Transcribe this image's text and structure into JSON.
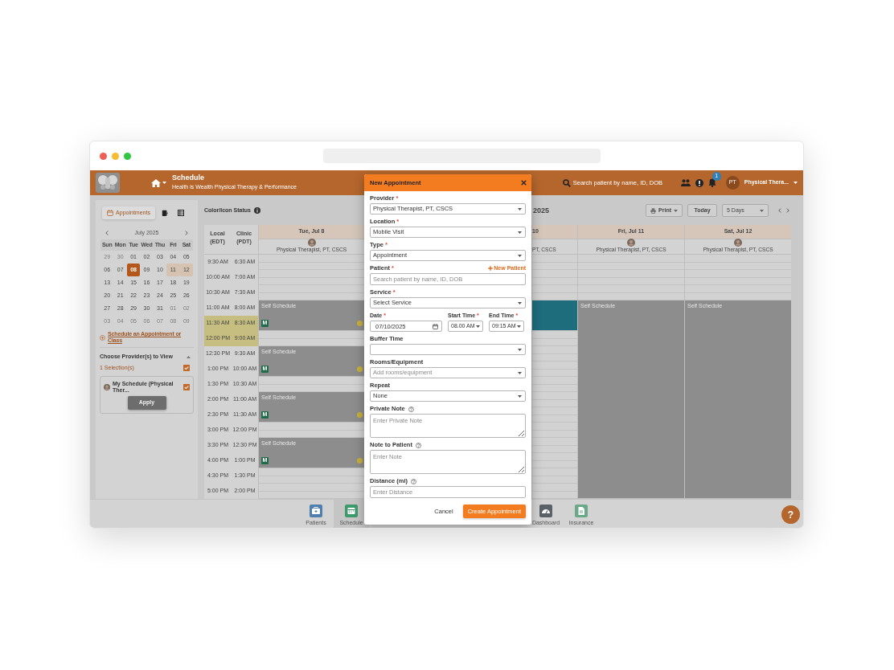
{
  "header": {
    "title": "Schedule",
    "subtitle": "Health is Wealth Physical Therapy & Performance",
    "search_placeholder": "Search patient by name, ID, DOB",
    "notification_count": "1",
    "avatar_initials": "PT",
    "user_name": "Physical Thera..."
  },
  "sidebar": {
    "view_buttons": [
      {
        "kind": "appointments",
        "label": "Appointments",
        "selected": true
      },
      {
        "kind": "notes",
        "selected": false
      },
      {
        "kind": "list",
        "selected": false
      }
    ],
    "month": "July 2025",
    "weekdays": [
      "Sun",
      "Mon",
      "Tue",
      "Wed",
      "Thu",
      "Fri",
      "Sat"
    ],
    "weeks": [
      [
        {
          "label": "29",
          "muted": true,
          "selected": false,
          "highlighted": false
        },
        {
          "label": "30",
          "muted": true,
          "selected": false,
          "highlighted": false
        },
        {
          "label": "01",
          "muted": false,
          "selected": false,
          "highlighted": false
        },
        {
          "label": "02",
          "muted": false,
          "selected": false,
          "highlighted": false
        },
        {
          "label": "03",
          "muted": false,
          "selected": false,
          "highlighted": false
        },
        {
          "label": "04",
          "muted": false,
          "selected": false,
          "highlighted": false
        },
        {
          "label": "05",
          "muted": false,
          "selected": false,
          "highlighted": false
        }
      ],
      [
        {
          "label": "06",
          "muted": false,
          "selected": false,
          "highlighted": false
        },
        {
          "label": "07",
          "muted": false,
          "selected": false,
          "highlighted": false
        },
        {
          "label": "08",
          "muted": false,
          "selected": true,
          "highlighted": false
        },
        {
          "label": "09",
          "muted": false,
          "selected": false,
          "highlighted": false
        },
        {
          "label": "10",
          "muted": false,
          "selected": false,
          "highlighted": false
        },
        {
          "label": "11",
          "muted": false,
          "selected": false,
          "highlighted": true
        },
        {
          "label": "12",
          "muted": false,
          "selected": false,
          "highlighted": true
        }
      ],
      [
        {
          "label": "13",
          "muted": false,
          "selected": false,
          "highlighted": false
        },
        {
          "label": "14",
          "muted": false,
          "selected": false,
          "highlighted": false
        },
        {
          "label": "15",
          "muted": false,
          "selected": false,
          "highlighted": false
        },
        {
          "label": "16",
          "muted": false,
          "selected": false,
          "highlighted": false
        },
        {
          "label": "17",
          "muted": false,
          "selected": false,
          "highlighted": false
        },
        {
          "label": "18",
          "muted": false,
          "selected": false,
          "highlighted": false
        },
        {
          "label": "19",
          "muted": false,
          "selected": false,
          "highlighted": false
        }
      ],
      [
        {
          "label": "20",
          "muted": false,
          "selected": false,
          "highlighted": false
        },
        {
          "label": "21",
          "muted": false,
          "selected": false,
          "highlighted": false
        },
        {
          "label": "22",
          "muted": false,
          "selected": false,
          "highlighted": false
        },
        {
          "label": "23",
          "muted": false,
          "selected": false,
          "highlighted": false
        },
        {
          "label": "24",
          "muted": false,
          "selected": false,
          "highlighted": false
        },
        {
          "label": "25",
          "muted": false,
          "selected": false,
          "highlighted": false
        },
        {
          "label": "26",
          "muted": false,
          "selected": false,
          "highlighted": false
        }
      ],
      [
        {
          "label": "27",
          "muted": false,
          "selected": false,
          "highlighted": false
        },
        {
          "label": "28",
          "muted": false,
          "selected": false,
          "highlighted": false
        },
        {
          "label": "29",
          "muted": false,
          "selected": false,
          "highlighted": false
        },
        {
          "label": "30",
          "muted": false,
          "selected": false,
          "highlighted": false
        },
        {
          "label": "31",
          "muted": false,
          "selected": false,
          "highlighted": false
        },
        {
          "label": "01",
          "muted": true,
          "selected": false,
          "highlighted": false
        },
        {
          "label": "02",
          "muted": true,
          "selected": false,
          "highlighted": false
        }
      ],
      [
        {
          "label": "03",
          "muted": true,
          "selected": false,
          "highlighted": false
        },
        {
          "label": "04",
          "muted": true,
          "selected": false,
          "highlighted": false
        },
        {
          "label": "05",
          "muted": true,
          "selected": false,
          "highlighted": false
        },
        {
          "label": "06",
          "muted": true,
          "selected": false,
          "highlighted": false
        },
        {
          "label": "07",
          "muted": true,
          "selected": false,
          "highlighted": false
        },
        {
          "label": "08",
          "muted": true,
          "selected": false,
          "highlighted": false
        },
        {
          "label": "09",
          "muted": true,
          "selected": false,
          "highlighted": false
        }
      ]
    ],
    "schedule_link": "Schedule an Appointment or Class",
    "providers": {
      "title": "Choose Provider(s) to View",
      "expanded": true,
      "selection_count": "1 Selection(s)",
      "all_checked": true,
      "items": [
        {
          "name": "My Schedule (Physical Ther...",
          "checked": true
        }
      ],
      "apply": "Apply"
    }
  },
  "calendar": {
    "status_label": "Color/Icon Status",
    "title": "2025",
    "print": "Print",
    "today": "Today",
    "range": "5 Days",
    "time_headers": [
      "Local (EDT)",
      "Clinic (PDT)"
    ],
    "times": [
      {
        "local": "9:30 AM",
        "clinic": "6:30 AM",
        "highlighted": false
      },
      {
        "local": "10:00 AM",
        "clinic": "7:00 AM",
        "highlighted": false
      },
      {
        "local": "10:30 AM",
        "clinic": "7:30 AM",
        "highlighted": false
      },
      {
        "local": "11:00 AM",
        "clinic": "8:00 AM",
        "highlighted": false
      },
      {
        "local": "11:30 AM",
        "clinic": "8:30 AM",
        "highlighted": true
      },
      {
        "local": "12:00 PM",
        "clinic": "9:00 AM",
        "highlighted": true
      },
      {
        "local": "12:30 PM",
        "clinic": "9:30 AM",
        "highlighted": false
      },
      {
        "local": "1:00 PM",
        "clinic": "10:00 AM",
        "highlighted": false
      },
      {
        "local": "1:30 PM",
        "clinic": "10:30 AM",
        "highlighted": false
      },
      {
        "local": "2:00 PM",
        "clinic": "11:00 AM",
        "highlighted": false
      },
      {
        "local": "2:30 PM",
        "clinic": "11:30 AM",
        "highlighted": false
      },
      {
        "local": "3:00 PM",
        "clinic": "12:00 PM",
        "highlighted": false
      },
      {
        "local": "3:30 PM",
        "clinic": "12:30 PM",
        "highlighted": false
      },
      {
        "local": "4:00 PM",
        "clinic": "1:00 PM",
        "highlighted": false
      },
      {
        "local": "4:30 PM",
        "clinic": "1:30 PM",
        "highlighted": false
      },
      {
        "local": "5:00 PM",
        "clinic": "2:00 PM",
        "highlighted": false
      }
    ],
    "days": [
      {
        "date": "Tue, Jul 8",
        "provider": "Physical Therapist, PT, CSCS",
        "avatar": true,
        "slots": [
          {
            "kind": "free"
          },
          {
            "kind": "free"
          },
          {
            "kind": "free"
          },
          {
            "kind": "busy",
            "label": "Self Schedule"
          },
          {
            "kind": "busy",
            "badge": "M",
            "dot": true
          },
          {
            "kind": "free"
          },
          {
            "kind": "busy",
            "label": "Self Schedule"
          },
          {
            "kind": "busy",
            "badge": "M",
            "dot": true
          },
          {
            "kind": "free"
          },
          {
            "kind": "busy",
            "label": "Self Schedule"
          },
          {
            "kind": "busy",
            "badge": "M",
            "dot": true
          },
          {
            "kind": "free"
          },
          {
            "kind": "busy",
            "label": "Self Schedule"
          },
          {
            "kind": "busy",
            "badge": "M",
            "dot": true
          },
          {
            "kind": "free"
          },
          {
            "kind": "free"
          }
        ]
      },
      {
        "date": "10",
        "provider": "PT, CSCS",
        "avatar": false,
        "slots": [
          {
            "kind": "free"
          },
          {
            "kind": "free"
          },
          {
            "kind": "free"
          },
          {
            "kind": "booked"
          },
          {
            "kind": "booked"
          },
          {
            "kind": "free"
          },
          {
            "kind": "free"
          },
          {
            "kind": "free"
          },
          {
            "kind": "free"
          },
          {
            "kind": "free"
          },
          {
            "kind": "free"
          },
          {
            "kind": "free"
          },
          {
            "kind": "free"
          },
          {
            "kind": "free"
          },
          {
            "kind": "free"
          },
          {
            "kind": "free"
          }
        ]
      },
      {
        "date": "Fri, Jul 11",
        "provider": "Physical Therapist, PT, CSCS",
        "avatar": true,
        "slots": [
          {
            "kind": "free"
          },
          {
            "kind": "free"
          },
          {
            "kind": "free"
          },
          {
            "kind": "busy",
            "label": "Self Schedule"
          },
          {
            "kind": "busy"
          },
          {
            "kind": "busy"
          },
          {
            "kind": "busy"
          },
          {
            "kind": "busy"
          },
          {
            "kind": "busy"
          },
          {
            "kind": "busy"
          },
          {
            "kind": "busy"
          },
          {
            "kind": "busy"
          },
          {
            "kind": "busy"
          },
          {
            "kind": "busy"
          },
          {
            "kind": "busy"
          },
          {
            "kind": "busy"
          }
        ]
      },
      {
        "date": "Sat, Jul 12",
        "provider": "Physical Therapist, PT, CSCS",
        "avatar": true,
        "slots": [
          {
            "kind": "free"
          },
          {
            "kind": "free"
          },
          {
            "kind": "free"
          },
          {
            "kind": "busy",
            "label": "Self Schedule"
          },
          {
            "kind": "busy"
          },
          {
            "kind": "busy"
          },
          {
            "kind": "busy"
          },
          {
            "kind": "busy"
          },
          {
            "kind": "busy"
          },
          {
            "kind": "busy"
          },
          {
            "kind": "busy"
          },
          {
            "kind": "busy"
          },
          {
            "kind": "busy"
          },
          {
            "kind": "busy"
          },
          {
            "kind": "busy"
          },
          {
            "kind": "busy"
          }
        ]
      }
    ]
  },
  "bottom_nav": [
    {
      "kind": "patients",
      "label": "Patients",
      "selected": false
    },
    {
      "kind": "schedule",
      "label": "Schedule",
      "selected": true
    },
    {
      "kind": "dashboard",
      "label": "Dashboard",
      "selected": false
    },
    {
      "kind": "insurance",
      "label": "Insurance",
      "selected": false
    }
  ],
  "help_label": "?",
  "modal": {
    "title": "New Appointment",
    "fields": [
      {
        "kind": "select",
        "label": "Provider",
        "required_mark": "*",
        "value": "Physical Therapist, PT, CSCS"
      },
      {
        "kind": "select",
        "label": "Location",
        "required_mark": "*",
        "value": "Mobile Visit"
      },
      {
        "kind": "select",
        "label": "Type",
        "required_mark": "*",
        "value": "Appointment"
      },
      {
        "kind": "input",
        "label": "Patient",
        "required_mark": "*",
        "placeholder": "Search patient by name, ID, DOB",
        "action": "New Patient"
      },
      {
        "kind": "select",
        "label": "Service",
        "required_mark": "*",
        "value": "Select Service"
      },
      {
        "kind": "row",
        "items": [
          {
            "kind": "date",
            "label": "Date",
            "required_mark": "*",
            "value": "07/10/2025"
          },
          {
            "kind": "select",
            "label": "Start Time",
            "required_mark": "*",
            "value": "08.00 AM"
          },
          {
            "kind": "select",
            "label": "End Time",
            "required_mark": "*",
            "value": "09:15 AM"
          }
        ]
      },
      {
        "kind": "select",
        "label": "Buffer Time"
      },
      {
        "kind": "select",
        "label": "Rooms/Equipment",
        "placeholder": "Add rooms/equipment"
      },
      {
        "kind": "select",
        "label": "Repeat",
        "value": "None"
      },
      {
        "kind": "textarea",
        "label": "Private Note",
        "help": true,
        "placeholder": "Enter Private Note"
      },
      {
        "kind": "textarea",
        "label": "Note to Patient",
        "help": true,
        "placeholder": "Enter Note"
      },
      {
        "kind": "input",
        "label": "Distance (mi)",
        "help": true,
        "placeholder": "Enter Distance"
      }
    ],
    "cancel": "Cancel",
    "submit": "Create Appointment"
  }
}
